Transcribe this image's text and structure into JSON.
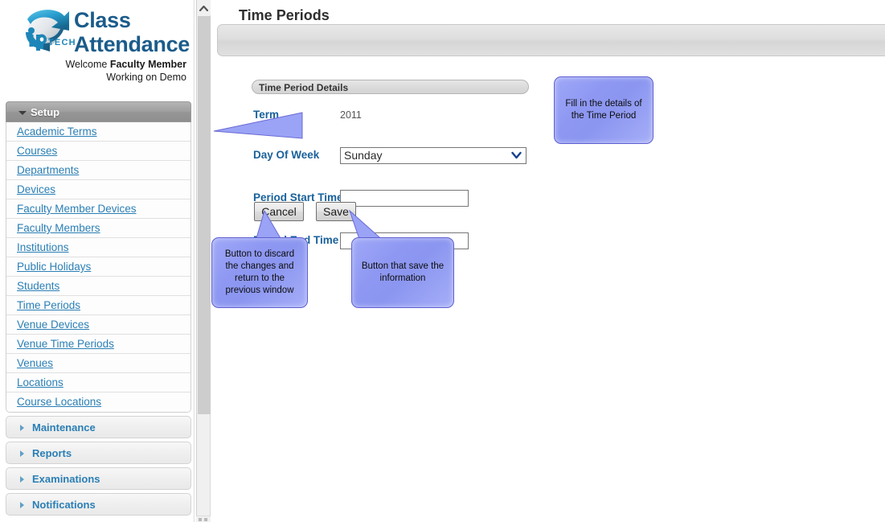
{
  "brand": {
    "title_line1": "Class",
    "title_line2": "Attendance",
    "logo_text": "iP TECH",
    "welcome_prefix": "Welcome ",
    "welcome_name": "Faculty Member",
    "working_on": "Working on Demo"
  },
  "sidebar": {
    "setup": {
      "label": "Setup",
      "expanded": true,
      "items": [
        {
          "label": "Academic Terms"
        },
        {
          "label": "Courses"
        },
        {
          "label": "Departments"
        },
        {
          "label": "Devices"
        },
        {
          "label": "Faculty Member Devices"
        },
        {
          "label": "Faculty Members"
        },
        {
          "label": "Institutions"
        },
        {
          "label": "Public Holidays"
        },
        {
          "label": "Students"
        },
        {
          "label": "Time Periods"
        },
        {
          "label": "Venue Devices"
        },
        {
          "label": "Venue Time Periods"
        },
        {
          "label": "Venues"
        },
        {
          "label": "Locations"
        },
        {
          "label": "Course Locations"
        }
      ]
    },
    "collapsed_sections": [
      {
        "label": "Maintenance"
      },
      {
        "label": "Reports"
      },
      {
        "label": "Examinations"
      },
      {
        "label": "Notifications"
      }
    ]
  },
  "main": {
    "page_title": "Time Periods",
    "section_title": "Time Period Details",
    "fields": [
      {
        "label": "Term",
        "type": "text",
        "value": "2011"
      },
      {
        "label": "Day Of Week",
        "type": "select",
        "value": "Sunday"
      },
      {
        "label": "Period Start Time",
        "type": "input",
        "value": "",
        "placeholder": ""
      },
      {
        "label": "Period End Time",
        "type": "input",
        "value": "",
        "placeholder": ""
      }
    ],
    "buttons": {
      "cancel": "Cancel",
      "save": "Save"
    }
  },
  "callouts": [
    {
      "text": "Fill in the details  of the Time Period"
    },
    {
      "text": "Button to discard the changes and return to the previous window"
    },
    {
      "text": "Button that save the information"
    }
  ],
  "colors": {
    "link": "#2a7fb5",
    "brand": "#1b5c8a",
    "field_label": "#19619b",
    "callout_fill": "#8e98f2",
    "callout_border": "#5f5fd0"
  }
}
